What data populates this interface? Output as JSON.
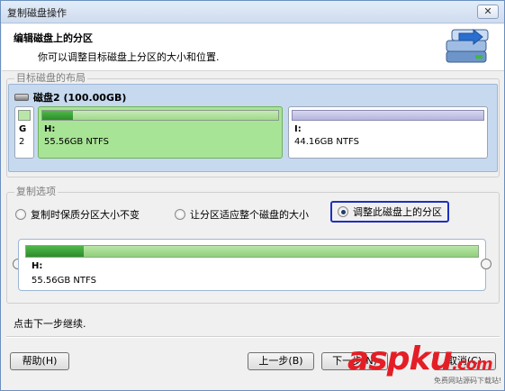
{
  "window": {
    "title": "复制磁盘操作",
    "close_label": "✕"
  },
  "header": {
    "title": "编辑磁盘上的分区",
    "subtitle": "你可以调整目标磁盘上分区的大小和位置.",
    "icon": "disk-copy-icon"
  },
  "layout_group": {
    "title": "目标磁盘的布局",
    "disk_label": "磁盘2 (100.00GB)",
    "partitions": [
      {
        "letter": "G",
        "info": "2"
      },
      {
        "letter": "H:",
        "info": "55.56GB NTFS",
        "used_fraction": 0.13
      },
      {
        "letter": "I:",
        "info": "44.16GB NTFS",
        "used_fraction": 0.0
      }
    ]
  },
  "options_group": {
    "title": "复制选项",
    "options": [
      {
        "label": "复制时保质分区大小不变",
        "selected": false
      },
      {
        "label": "让分区适应整个磁盘的大小",
        "selected": false
      },
      {
        "label": "调整此磁盘上的分区",
        "selected": true
      }
    ],
    "resize_partition": {
      "letter": "H:",
      "info": "55.56GB NTFS",
      "used_fraction": 0.13
    }
  },
  "hint": "点击下一步继续.",
  "buttons": {
    "help": "帮助(H)",
    "back": "上一步(B)",
    "next": "下一步(N)",
    "cancel": "取消(C)"
  },
  "watermark": {
    "main": "aspku",
    "suffix": ".com",
    "sub": "免费网站源码下载站!"
  },
  "colors": {
    "accent_blue": "#1d2fc1",
    "partition_green": "#2c8d2a",
    "watermark_red": "#e41e26"
  }
}
